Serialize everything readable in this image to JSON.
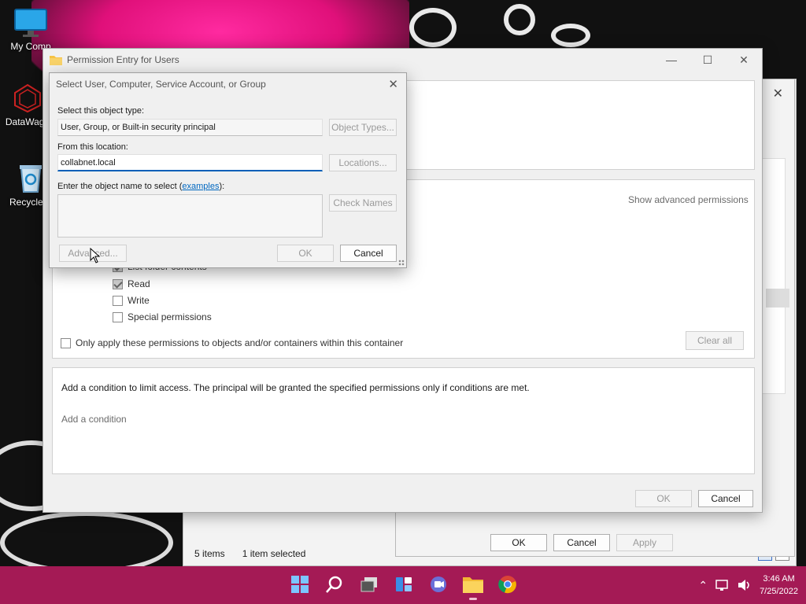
{
  "desktop": {
    "icons": [
      {
        "label": "My Comp",
        "icon": "monitor-icon"
      },
      {
        "label": "DataWago",
        "icon": "datawago-icon"
      },
      {
        "label": "Recycle B",
        "icon": "recycle-bin-icon"
      }
    ]
  },
  "explorer": {
    "status_items": "5 items",
    "status_selected": "1 item selected"
  },
  "properties": {
    "ok_label": "OK",
    "cancel_label": "Cancel",
    "apply_label": "Apply"
  },
  "permission_entry": {
    "title": "Permission Entry for Users",
    "show_advanced": "Show advanced permissions",
    "permissions": [
      {
        "label": "List folder contents",
        "checked": true
      },
      {
        "label": "Read",
        "checked": true
      },
      {
        "label": "Write",
        "checked": false
      },
      {
        "label": "Special permissions",
        "checked": false
      }
    ],
    "only_apply_label": "Only apply these permissions to objects and/or containers within this container",
    "clear_all_label": "Clear all",
    "condition_text": "Add a condition to limit access. The principal will be granted the specified permissions only if conditions are met.",
    "add_condition_label": "Add a condition",
    "ok_label": "OK",
    "cancel_label": "Cancel"
  },
  "select_dialog": {
    "title": "Select User, Computer, Service Account, or Group",
    "object_type_label": "Select this object type:",
    "object_type_value": "User, Group, or Built-in security principal",
    "object_types_button": "Object Types...",
    "location_label": "From this location:",
    "location_value": "collabnet.local",
    "locations_button": "Locations...",
    "object_name_label_prefix": "Enter the object name to select (",
    "examples_link": "examples",
    "object_name_label_suffix": "):",
    "object_name_value": "",
    "check_names_button": "Check Names",
    "advanced_button": "Advanced...",
    "ok_button": "OK",
    "cancel_button": "Cancel"
  },
  "taskbar": {
    "apps": [
      "windows-start-icon",
      "search-icon",
      "task-view-icon",
      "widgets-icon",
      "teams-chat-icon",
      "file-explorer-icon",
      "chrome-icon"
    ],
    "time": "3:46 AM",
    "date": "7/25/2022",
    "colors": {
      "taskbar": "#a41a55",
      "accent": "#005fb8"
    }
  }
}
